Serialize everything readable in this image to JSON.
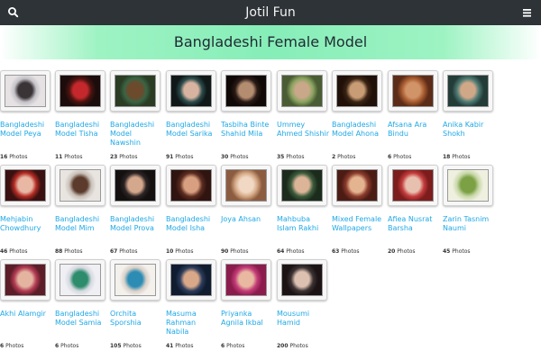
{
  "header": {
    "site_title": "Jotil Fun",
    "search_icon": "search-icon",
    "menu_icon": "menu-icon"
  },
  "page": {
    "heading": "Bangladeshi Female Model",
    "photos_label": "Photos"
  },
  "albums": [
    {
      "name": "Bangladeshi Model Peya",
      "count": "16",
      "colors": [
        "#c4c2c8",
        "#3a3436",
        "#e6e2e4"
      ]
    },
    {
      "name": "Bangladeshi Model Tisha",
      "count": "11",
      "colors": [
        "#4a1410",
        "#c4282c",
        "#1c0c0c"
      ]
    },
    {
      "name": "Bangladeshi Model Nawshin",
      "count": "23",
      "colors": [
        "#3a6444",
        "#6c4a2c",
        "#2a3c24"
      ]
    },
    {
      "name": "Bangladeshi Model Sarika",
      "count": "91",
      "colors": [
        "#2c4c4c",
        "#d8b4a0",
        "#101818"
      ]
    },
    {
      "name": "Tasbiha Binte Shahid Mila",
      "count": "30",
      "colors": [
        "#2a1a16",
        "#b48c70",
        "#100806"
      ]
    },
    {
      "name": "Ummey Ahmed Shishir",
      "count": "35",
      "colors": [
        "#8aa460",
        "#c8a888",
        "#4a5c34"
      ]
    },
    {
      "name": "Bangladeshi Model Ahona",
      "count": "2",
      "colors": [
        "#3a2414",
        "#c89c74",
        "#201008"
      ]
    },
    {
      "name": "Afsana Ara Bindu",
      "count": "6",
      "colors": [
        "#a85c30",
        "#d09468",
        "#5c2c18"
      ]
    },
    {
      "name": "Anika Kabir Shokh",
      "count": "18",
      "colors": [
        "#4c7a74",
        "#d0a888",
        "#243c38"
      ]
    },
    {
      "name": "Mehjabin Chowdhury",
      "count": "46",
      "colors": [
        "#b42c24",
        "#e8b8a4",
        "#3a1010"
      ]
    },
    {
      "name": "Bangladeshi Model Mim",
      "count": "88",
      "colors": [
        "#c8c0b8",
        "#5c3a2c",
        "#e8e4e0"
      ]
    },
    {
      "name": "Bangladeshi Model Prova",
      "count": "67",
      "colors": [
        "#2c2424",
        "#d4a88c",
        "#141010"
      ]
    },
    {
      "name": "Bangladeshi Model Isha",
      "count": "10",
      "colors": [
        "#5c2c20",
        "#d8a080",
        "#301410"
      ]
    },
    {
      "name": "Joya Ahsan",
      "count": "90",
      "colors": [
        "#d4a884",
        "#f0d8c4",
        "#8c5c40"
      ]
    },
    {
      "name": "Mahbuba Islam Rakhi",
      "count": "64",
      "colors": [
        "#3c5c3c",
        "#dcb498",
        "#1c2c1c"
      ]
    },
    {
      "name": "Mixed Female Wallpapers",
      "count": "63",
      "colors": [
        "#8c3c2c",
        "#e4b490",
        "#4c1c14"
      ]
    },
    {
      "name": "Afiea Nusrat Barsha",
      "count": "20",
      "colors": [
        "#c43c3c",
        "#e8c0b0",
        "#7c1c1c"
      ]
    },
    {
      "name": "Zarin Tasnim Naumi",
      "count": "45",
      "colors": [
        "#c8d8a8",
        "#7ca044",
        "#f0f0e0"
      ]
    },
    {
      "name": "Akhi Alamgir",
      "count": "6",
      "colors": [
        "#b43c54",
        "#e4b4a0",
        "#5c1c28"
      ]
    },
    {
      "name": "Bangladeshi Model Samia",
      "count": "6",
      "colors": [
        "#d4d8e0",
        "#2c8c6c",
        "#f0f0f4"
      ]
    },
    {
      "name": "Orchita Sporshia",
      "count": "105",
      "colors": [
        "#d8d0c8",
        "#2c8cb4",
        "#f4f0ec"
      ]
    },
    {
      "name": "Masuma Rahman Nabila",
      "count": "41",
      "colors": [
        "#2c3c5c",
        "#d8a888",
        "#101c30"
      ]
    },
    {
      "name": "Priyanka Agnila Ikbal",
      "count": "6",
      "colors": [
        "#c43c78",
        "#e8b8a0",
        "#8c1c4c"
      ]
    },
    {
      "name": "Mousumi Hamid",
      "count": "200",
      "colors": [
        "#3c3434",
        "#dcc0b0",
        "#1c1414"
      ]
    }
  ]
}
